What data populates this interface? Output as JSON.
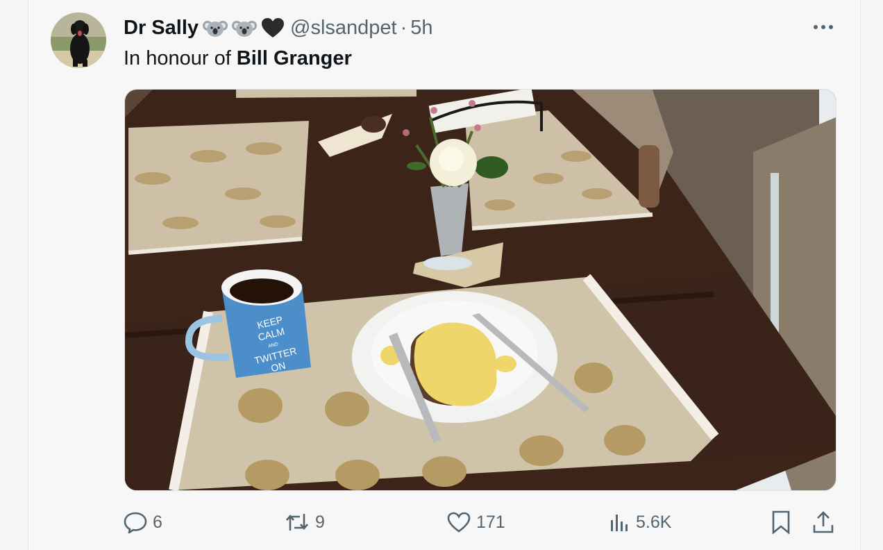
{
  "post": {
    "author": {
      "display_name": "Dr Sally",
      "name_emojis": [
        "koala-emoji",
        "koala-emoji",
        "black-heart-emoji"
      ],
      "handle": "@slsandpet",
      "separator": "·",
      "time": "5h"
    },
    "text_prefix": "In honour of",
    "text_bold": "Bill Granger",
    "media": {
      "mug_text": [
        "KEEP",
        "CALM",
        "AND",
        "TWITTER",
        "ON"
      ]
    },
    "actions": {
      "replies": "6",
      "reposts": "9",
      "likes": "171",
      "views": "5.6K"
    }
  },
  "colors": {
    "text": "#0f1419",
    "secondary": "#536471",
    "background": "#f7f7f7"
  },
  "icons": [
    "more-icon",
    "reply-icon",
    "repost-icon",
    "like-icon",
    "views-icon",
    "bookmark-icon",
    "share-icon"
  ]
}
